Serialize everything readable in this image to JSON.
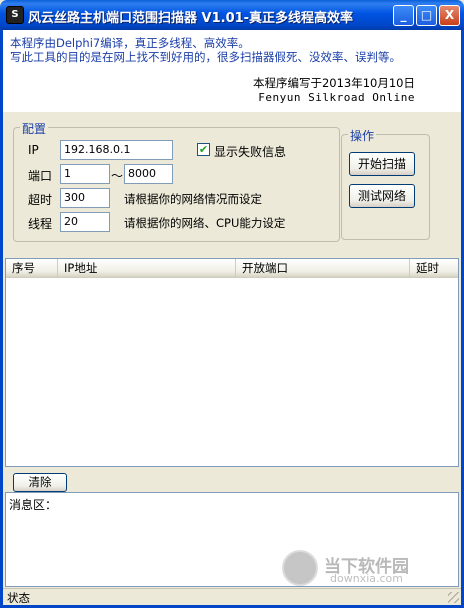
{
  "window": {
    "title": "风云丝路主机端口范围扫描器 V1.01-真正多线程高效率",
    "icon_label": "S",
    "buttons": {
      "minimize": "_",
      "maximize": "□",
      "close": "X"
    }
  },
  "info": {
    "line1": "本程序由Delphi7编译，真正多线程、高效率。",
    "line2": "写此工具的目的是在网上找不到好用的，很多扫描器假死、没效率、误判等。",
    "author_line": "本程序编写于2013年10月10日",
    "author_name": "Fenyun Silkroad Online"
  },
  "config": {
    "title": "配置",
    "ip_label": "IP",
    "ip_value": "192.168.0.1",
    "show_fail_label": "显示失败信息",
    "show_fail_checked": true,
    "port_label": "端口",
    "port_from": "1",
    "port_sep": "～",
    "port_to": "8000",
    "timeout_label": "超时",
    "timeout_value": "300",
    "timeout_hint": "请根据你的网络情况而设定",
    "threads_label": "线程",
    "threads_value": "20",
    "threads_hint": "请根据你的网络、CPU能力设定"
  },
  "operations": {
    "title": "操作",
    "start_label": "开始扫描",
    "test_label": "测试网络"
  },
  "results": {
    "columns": [
      "序号",
      "IP地址",
      "开放端口",
      "延时"
    ],
    "rows": []
  },
  "messages": {
    "clear_label": "清除",
    "area_label": "消息区："
  },
  "status": {
    "text": "状态"
  },
  "watermark": {
    "text": "当下软件园",
    "sub": "downxia.com"
  }
}
